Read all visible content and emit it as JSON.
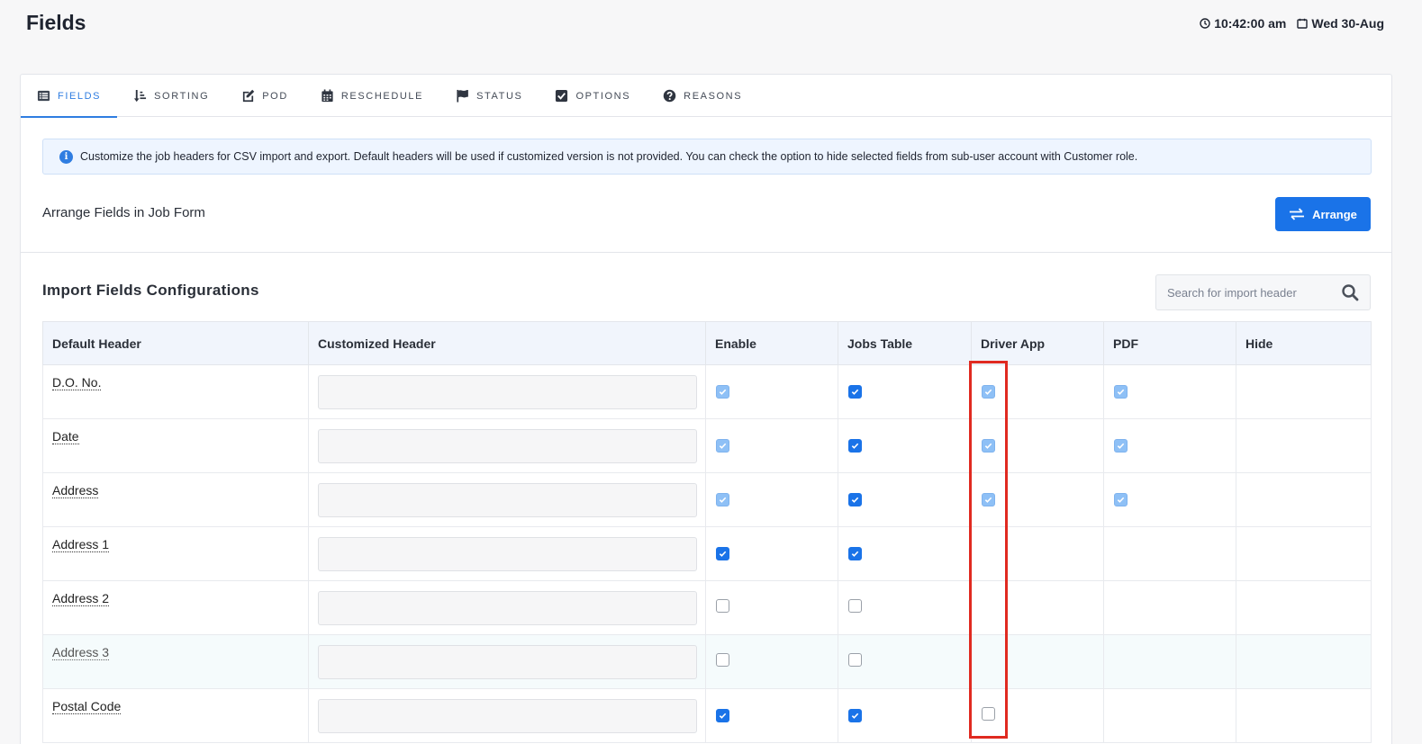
{
  "page": {
    "title": "Fields",
    "time": "10:42:00 am",
    "date": "Wed 30-Aug"
  },
  "tabs": [
    {
      "label": "FIELDS",
      "icon": "list-icon",
      "active": true
    },
    {
      "label": "SORTING",
      "icon": "sort-icon",
      "active": false
    },
    {
      "label": "POD",
      "icon": "edit-icon",
      "active": false
    },
    {
      "label": "RESCHEDULE",
      "icon": "calendar-icon",
      "active": false
    },
    {
      "label": "STATUS",
      "icon": "flag-icon",
      "active": false
    },
    {
      "label": "OPTIONS",
      "icon": "checkbox-icon",
      "active": false
    },
    {
      "label": "REASONS",
      "icon": "question-circle-icon",
      "active": false
    }
  ],
  "info": {
    "text": "Customize the job headers for CSV import and export. Default headers will be used if customized version is not provided. You can check the option to hide selected fields from sub-user account with Customer role."
  },
  "arrange": {
    "label": "Arrange Fields in Job Form",
    "button_label": "Arrange"
  },
  "import_section": {
    "title": "Import Fields Configurations",
    "search_placeholder": "Search for import header"
  },
  "table": {
    "columns": [
      "Default Header",
      "Customized Header",
      "Enable",
      "Jobs Table",
      "Driver App",
      "PDF",
      "Hide"
    ],
    "rows": [
      {
        "header": "D.O. No.",
        "custom": "",
        "enable": "disabled-checked",
        "jobs_table": "checked",
        "driver_app": "disabled-checked",
        "pdf": "disabled-checked",
        "hide": "none"
      },
      {
        "header": "Date",
        "custom": "",
        "enable": "disabled-checked",
        "jobs_table": "checked",
        "driver_app": "disabled-checked",
        "pdf": "disabled-checked",
        "hide": "none"
      },
      {
        "header": "Address",
        "custom": "",
        "enable": "disabled-checked",
        "jobs_table": "checked",
        "driver_app": "disabled-checked",
        "pdf": "disabled-checked",
        "hide": "none"
      },
      {
        "header": "Address 1",
        "custom": "",
        "enable": "checked",
        "jobs_table": "checked",
        "driver_app": "none",
        "pdf": "none",
        "hide": "none"
      },
      {
        "header": "Address 2",
        "custom": "",
        "enable": "unchecked",
        "jobs_table": "unchecked",
        "driver_app": "none",
        "pdf": "none",
        "hide": "none"
      },
      {
        "header": "Address 3",
        "custom": "",
        "enable": "unchecked",
        "jobs_table": "unchecked",
        "driver_app": "none",
        "pdf": "none",
        "hide": "none"
      },
      {
        "header": "Postal Code",
        "custom": "",
        "enable": "checked",
        "jobs_table": "checked",
        "driver_app": "unchecked",
        "pdf": "none",
        "hide": "none"
      }
    ]
  },
  "colors": {
    "accent": "#1a73e8",
    "tab_active": "#2f7de1",
    "highlight_box": "#e02a20"
  }
}
